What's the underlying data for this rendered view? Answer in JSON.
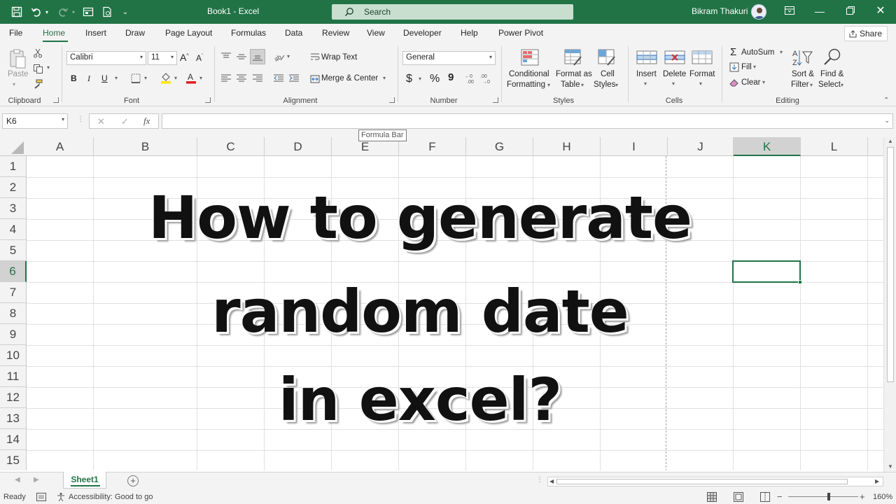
{
  "window": {
    "title": "Book1  -  Excel",
    "search_placeholder": "Search",
    "user_name": "Bikram Thakuri",
    "accent": "#217346"
  },
  "tabs": [
    "File",
    "Home",
    "Insert",
    "Draw",
    "Page Layout",
    "Formulas",
    "Data",
    "Review",
    "View",
    "Developer",
    "Help",
    "Power Pivot"
  ],
  "active_tab": "Home",
  "share_label": "Share",
  "ribbon": {
    "clipboard": {
      "label": "Clipboard",
      "paste": "Paste"
    },
    "font": {
      "label": "Font",
      "font_name": "Calibri",
      "font_size": "11",
      "bold": "B",
      "italic": "I",
      "underline": "U"
    },
    "alignment": {
      "label": "Alignment",
      "wrap_text": "Wrap Text",
      "merge_center": "Merge & Center"
    },
    "number": {
      "label": "Number",
      "format": "General",
      "currency": "$",
      "percent": "%",
      "comma": "9"
    },
    "styles": {
      "label": "Styles",
      "conditional_1": "Conditional",
      "conditional_2": "Formatting",
      "format_table_1": "Format as",
      "format_table_2": "Table",
      "cell_styles_1": "Cell",
      "cell_styles_2": "Styles"
    },
    "cells": {
      "label": "Cells",
      "insert": "Insert",
      "delete": "Delete",
      "format": "Format"
    },
    "editing": {
      "label": "Editing",
      "autosum": "AutoSum",
      "fill": "Fill",
      "clear": "Clear",
      "sort_1": "Sort &",
      "sort_2": "Filter",
      "find_1": "Find &",
      "find_2": "Select"
    }
  },
  "formula_bar": {
    "name_box": "K6",
    "fx": "fx",
    "value": "",
    "tooltip": "Formula Bar"
  },
  "columns": [
    "A",
    "B",
    "C",
    "D",
    "E",
    "F",
    "G",
    "H",
    "I",
    "J",
    "K",
    "L"
  ],
  "rows": [
    "1",
    "2",
    "3",
    "4",
    "5",
    "6",
    "7",
    "8",
    "9",
    "10",
    "11",
    "12",
    "13",
    "14",
    "15"
  ],
  "selected_cell": {
    "column": "K",
    "row": "6"
  },
  "overlay_text": {
    "line1": "How to generate",
    "line2": "random date",
    "line3": "in excel?"
  },
  "sheets": [
    "Sheet1"
  ],
  "status": {
    "ready": "Ready",
    "accessibility": "Accessibility: Good to go",
    "zoom": "160%"
  }
}
